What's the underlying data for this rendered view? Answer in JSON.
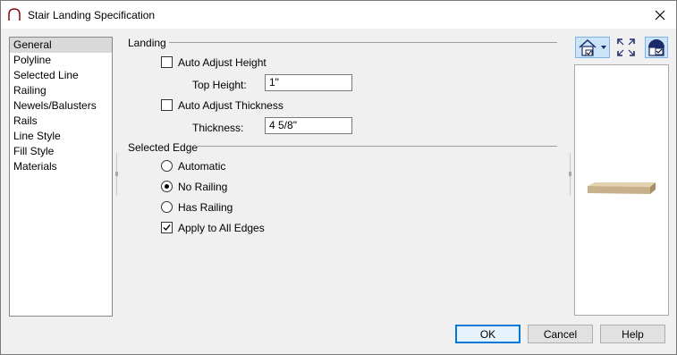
{
  "window": {
    "title": "Stair Landing Specification",
    "icon": "stair-arch-icon",
    "close_icon": "close-icon"
  },
  "sidebar": {
    "selected_index": 0,
    "items": [
      {
        "label": "General"
      },
      {
        "label": "Polyline"
      },
      {
        "label": "Selected Line"
      },
      {
        "label": "Railing"
      },
      {
        "label": "Newels/Balusters"
      },
      {
        "label": "Rails"
      },
      {
        "label": "Line Style"
      },
      {
        "label": "Fill Style"
      },
      {
        "label": "Materials"
      }
    ]
  },
  "landing": {
    "header": "Landing",
    "auto_adjust_height": {
      "label": "Auto Adjust Height",
      "checked": false
    },
    "top_height": {
      "label": "Top Height:",
      "value": "1\""
    },
    "auto_adjust_thickness": {
      "label": "Auto Adjust Thickness",
      "checked": false
    },
    "thickness": {
      "label": "Thickness:",
      "value": "4 5/8\""
    }
  },
  "selected_edge": {
    "header": "Selected Edge",
    "options": [
      {
        "label": "Automatic",
        "selected": false
      },
      {
        "label": "No Railing",
        "selected": true
      },
      {
        "label": "Has Railing",
        "selected": false
      }
    ],
    "apply_all": {
      "label": "Apply to All Edges",
      "checked": true
    }
  },
  "preview_toolbar": {
    "icons": [
      "house-view-dropdown-icon",
      "fill-window-icon",
      "show-camera-icon"
    ]
  },
  "buttons": {
    "ok": "OK",
    "cancel": "Cancel",
    "help": "Help"
  },
  "colors": {
    "accent": "#0078d7",
    "selection": "#d9d9d9",
    "landing_wood": "#c8b08a"
  }
}
